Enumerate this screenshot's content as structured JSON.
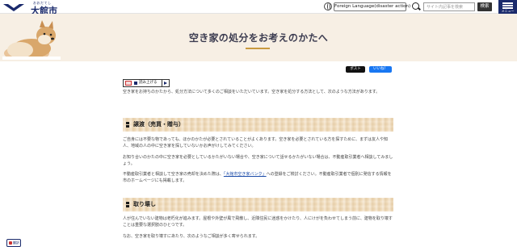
{
  "header": {
    "logo_ruby": "おおだてし",
    "logo_name": "大館市",
    "language_button": "Foreign Language(disaster action)",
    "search_placeholder": "サイト内記事を検索",
    "search_button": "検索",
    "menu_label": "メニュー",
    "brand_color": "#1a2a6c"
  },
  "hero": {
    "title": "空き家の処分をお考えのかたへ",
    "background": "#f7efe4",
    "accent": "#c99a3f"
  },
  "share": {
    "x_label": "ポスト",
    "facebook_label": "いいね！"
  },
  "readbar": {
    "label": "読み上げる"
  },
  "content": {
    "intro": "空き家をお持ちのかたから、処分方法について多くのご相談をいただいています。空き家を処分する方法として、次のような方法があります。",
    "sections": [
      {
        "heading": "譲渡（売買・贈与）",
        "paragraphs": [
          "ご自身には不要な物であっても、ほかのかたが必要とされていることがよくあります。空き家を必要とされている方を探すために、まずは友人や知人、地域の人の中に空き家を探していないかお声がけしてみてください。",
          "お知り合いのかたの中に空き家を必要としているかたがいない場合や、空き家について話せるかたがいない場合は、不動産取引業者へ相談してみましょう。"
        ],
        "bank_pre": "不動産取引業者と相談して空き家の売却を決めた際は、",
        "bank_link": "「大館市空き家バンク」",
        "bank_post": "への登録をご検討ください。不動産取引業者で個別に発信する情報を市のホームページにも掲載します。"
      },
      {
        "heading": "取り壊し",
        "paragraphs": [
          "人が住んでいない建物は老朽化が進みます。屋根や外壁が風で飛散し、近隣住民に迷惑をかけたり、人にけがを負わせてしまう前に、建物を取り壊すことは重要な選択肢のひとつです。",
          "なお、空き家を取り壊すにあたり、次のようなご相談が多く寄せられます。"
        ]
      }
    ]
  },
  "back_to_top": "翻訳"
}
